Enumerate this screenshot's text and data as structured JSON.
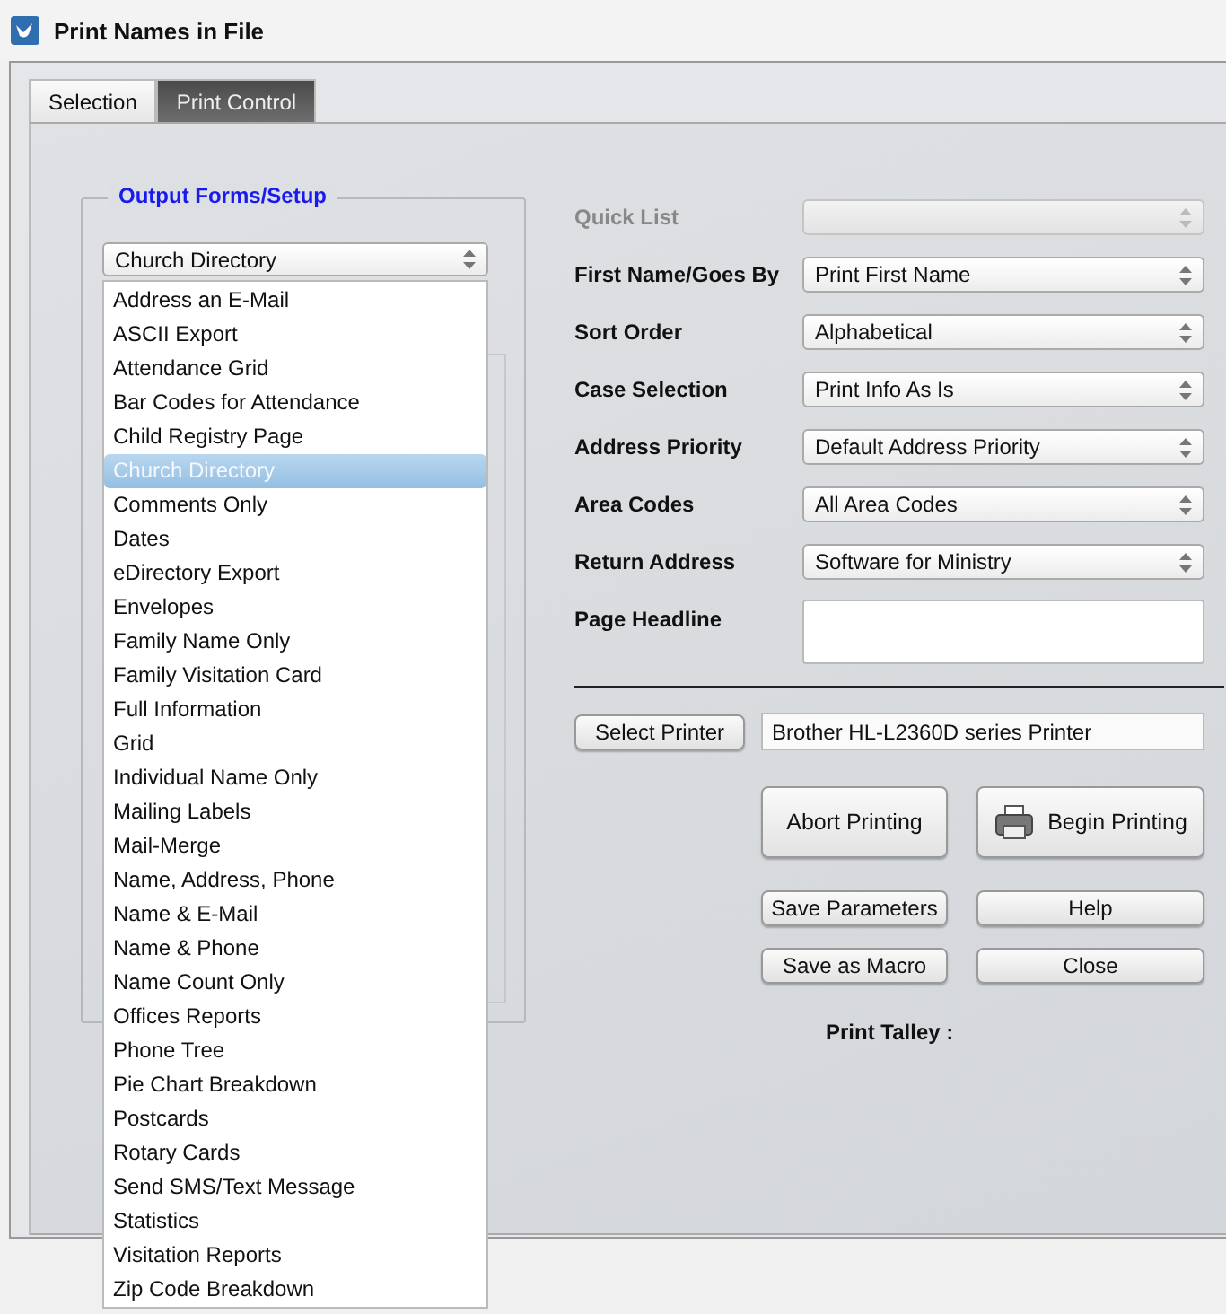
{
  "window": {
    "title": "Print Names in File"
  },
  "tabs": [
    {
      "label": "Selection",
      "selected": false
    },
    {
      "label": "Print Control",
      "selected": true
    }
  ],
  "output_forms": {
    "title": "Output Forms/Setup",
    "value": "Church Directory",
    "expanded": true,
    "options": [
      {
        "label": "Address an E-Mail",
        "selected": false
      },
      {
        "label": "ASCII Export",
        "selected": false
      },
      {
        "label": "Attendance Grid",
        "selected": false
      },
      {
        "label": "Bar Codes for Attendance",
        "selected": false
      },
      {
        "label": "Child Registry Page",
        "selected": false
      },
      {
        "label": "Church Directory",
        "selected": true
      },
      {
        "label": "Comments Only",
        "selected": false
      },
      {
        "label": "Dates",
        "selected": false
      },
      {
        "label": "eDirectory Export",
        "selected": false
      },
      {
        "label": "Envelopes",
        "selected": false
      },
      {
        "label": "Family Name Only",
        "selected": false
      },
      {
        "label": "Family Visitation Card",
        "selected": false
      },
      {
        "label": "Full Information",
        "selected": false
      },
      {
        "label": "Grid",
        "selected": false
      },
      {
        "label": "Individual Name Only",
        "selected": false
      },
      {
        "label": "Mailing Labels",
        "selected": false
      },
      {
        "label": "Mail-Merge",
        "selected": false
      },
      {
        "label": "Name, Address,  Phone",
        "selected": false
      },
      {
        "label": "Name & E-Mail",
        "selected": false
      },
      {
        "label": "Name & Phone",
        "selected": false
      },
      {
        "label": "Name Count Only",
        "selected": false
      },
      {
        "label": "Offices Reports",
        "selected": false
      },
      {
        "label": "Phone Tree",
        "selected": false
      },
      {
        "label": "Pie Chart Breakdown",
        "selected": false
      },
      {
        "label": "Postcards",
        "selected": false
      },
      {
        "label": "Rotary Cards",
        "selected": false
      },
      {
        "label": "Send SMS/Text Message",
        "selected": false
      },
      {
        "label": "Statistics",
        "selected": false
      },
      {
        "label": "Visitation Reports",
        "selected": false
      },
      {
        "label": "Zip Code Breakdown",
        "selected": false
      }
    ]
  },
  "fields": [
    {
      "kind": "select",
      "label": "Quick List",
      "disabled": true
    },
    {
      "kind": "select",
      "label": "First Name/Goes By",
      "value": "Print First Name",
      "disabled": false
    },
    {
      "kind": "select",
      "label": "Sort Order",
      "value": "Alphabetical",
      "disabled": false
    },
    {
      "kind": "select",
      "label": "Case Selection",
      "value": "Print Info As Is",
      "disabled": false
    },
    {
      "kind": "select",
      "label": "Address Priority",
      "value": "Default Address Priority",
      "disabled": false
    },
    {
      "kind": "select",
      "label": "Area Codes",
      "value": "All Area Codes",
      "disabled": false
    },
    {
      "kind": "select",
      "label": "Return Address",
      "value": "Software for Ministry",
      "disabled": false
    },
    {
      "kind": "textarea",
      "label": "Page Headline",
      "disabled": false
    }
  ],
  "printer": {
    "button": "Select Printer",
    "value": "Brother HL-L2360D series Printer"
  },
  "large_buttons": [
    {
      "label": "Abort Printing",
      "icon": false
    },
    {
      "label": "Begin Printing",
      "icon": true
    }
  ],
  "small_buttons": [
    {
      "label": "Save Parameters"
    },
    {
      "label": "Help"
    },
    {
      "label": "Save as Macro"
    },
    {
      "label": "Close"
    }
  ],
  "talley": {
    "label": "Print Talley :"
  }
}
